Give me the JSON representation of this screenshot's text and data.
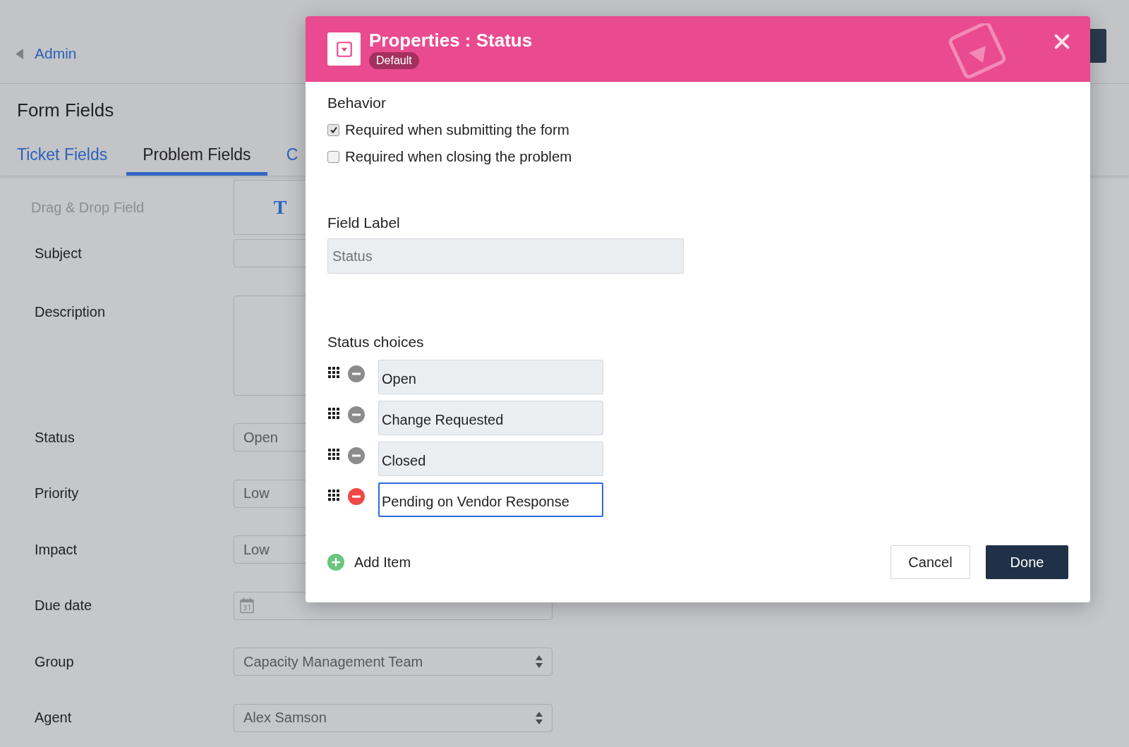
{
  "header": {
    "back_link": "Admin"
  },
  "page_title": "Form Fields",
  "tabs": [
    {
      "label": "Ticket Fields",
      "selected": false
    },
    {
      "label": "Problem Fields",
      "selected": true
    },
    {
      "label": "C",
      "selected": false
    }
  ],
  "palette": {
    "label": "Drag & Drop Field",
    "tile": "T"
  },
  "fields": [
    {
      "label": "Subject",
      "kind": "text"
    },
    {
      "label": "Description",
      "kind": "textarea"
    },
    {
      "label": "Status",
      "kind": "text",
      "value": "Open"
    },
    {
      "label": "Priority",
      "kind": "text",
      "value": "Low"
    },
    {
      "label": "Impact",
      "kind": "text",
      "value": "Low"
    },
    {
      "label": "Due date",
      "kind": "date"
    },
    {
      "label": "Group",
      "kind": "select",
      "value": "Capacity Management Team"
    },
    {
      "label": "Agent",
      "kind": "select",
      "value": "Alex Samson"
    }
  ],
  "dialog": {
    "title": "Properties : Status",
    "badge": "Default",
    "behavior": {
      "heading": "Behavior",
      "options": [
        {
          "label": "Required when submitting the form",
          "checked": true
        },
        {
          "label": "Required when closing the problem",
          "checked": false
        }
      ]
    },
    "field_label": {
      "label": "Field Label",
      "value": "Status",
      "disabled": true
    },
    "choices": {
      "heading": "Status choices",
      "items": [
        {
          "value": "Open",
          "focused": false
        },
        {
          "value": "Change Requested",
          "focused": false
        },
        {
          "value": "Closed",
          "focused": false
        },
        {
          "value": "Pending on Vendor Response",
          "focused": true
        }
      ]
    },
    "add_item": "Add Item",
    "buttons": [
      {
        "label": "Cancel",
        "kind": "secondary"
      },
      {
        "label": "Done",
        "kind": "primary"
      }
    ]
  }
}
